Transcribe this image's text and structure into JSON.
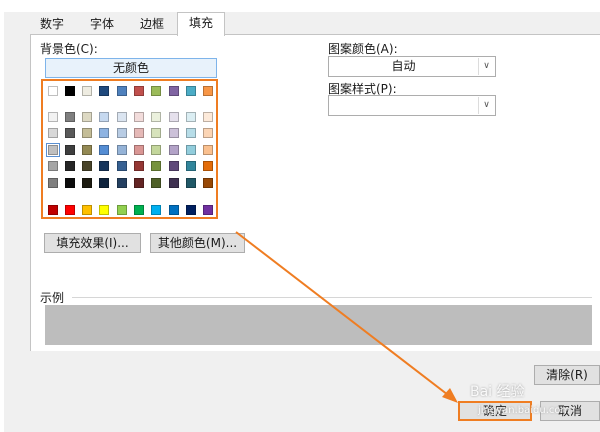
{
  "tabs": [
    {
      "label": "数字"
    },
    {
      "label": "字体"
    },
    {
      "label": "边框"
    },
    {
      "label": "填充"
    }
  ],
  "background_color": {
    "label": "背景色(C):",
    "no_color_label": "无颜色",
    "palette": {
      "standard_row": [
        "#ffffff",
        "#000000",
        "#eeece1",
        "#1f497d",
        "#4f81bd",
        "#c0504d",
        "#9bbb59",
        "#8064a2",
        "#4bacc6",
        "#f79646"
      ],
      "theme_rows": [
        [
          "#f2f2f2",
          "#7f7f7f",
          "#ddd9c3",
          "#c6d9f0",
          "#dbe5f1",
          "#f2dcdb",
          "#ebf1dd",
          "#e5e0ec",
          "#dbeef3",
          "#fdeada"
        ],
        [
          "#d8d8d8",
          "#595959",
          "#c4bd97",
          "#8db3e2",
          "#b8cce4",
          "#e5b9b7",
          "#d7e3bc",
          "#ccc1d9",
          "#b7dde8",
          "#fbd5b5"
        ],
        [
          "#bfbfbf",
          "#3f3f3f",
          "#938953",
          "#548dd4",
          "#95b3d7",
          "#d99694",
          "#c3d69b",
          "#b2a2c7",
          "#92cddc",
          "#fac08f"
        ],
        [
          "#a5a5a5",
          "#262626",
          "#494429",
          "#17365d",
          "#366092",
          "#953734",
          "#76923c",
          "#5f497a",
          "#31859b",
          "#e36c09"
        ],
        [
          "#7f7f7f",
          "#0c0c0c",
          "#1d1b10",
          "#0f243e",
          "#244061",
          "#632423",
          "#4f6128",
          "#3f3151",
          "#205867",
          "#974806"
        ]
      ],
      "extra_row": [
        "#c00000",
        "#ff0000",
        "#ffc000",
        "#ffff00",
        "#92d050",
        "#00b050",
        "#00b0f0",
        "#0070c0",
        "#002060",
        "#7030a0"
      ]
    },
    "fill_effects_button": "填充效果(I)...",
    "more_colors_button": "其他颜色(M)..."
  },
  "pattern_color": {
    "label": "图案颜色(A):",
    "value": "自动"
  },
  "pattern_style": {
    "label": "图案样式(P):",
    "value": ""
  },
  "sample": {
    "label": "示例",
    "color": "#bdbdbd"
  },
  "buttons": {
    "clear": "清除(R)",
    "ok": "确定",
    "cancel": "取消"
  },
  "annotation_color": "#ef7d22",
  "watermark": {
    "logo": "Bai 经验",
    "url": "jingyan.baidu.com"
  }
}
